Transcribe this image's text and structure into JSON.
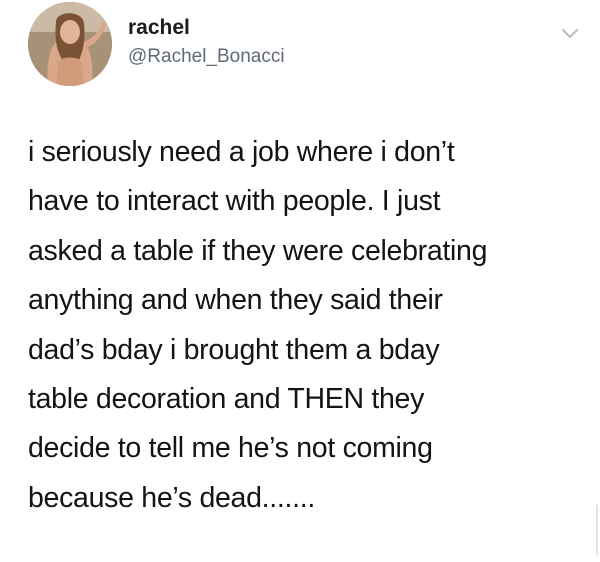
{
  "user": {
    "display_name": "rachel",
    "handle": "@Rachel_Bonacci"
  },
  "tweet": {
    "lines": [
      "i seriously need a job where i don’t",
      "have to interact with people. I just",
      "asked a table if they were celebrating",
      "anything and when they said their",
      "dad’s bday i brought them a bday",
      "table decoration and THEN they",
      "decide to tell me he’s not coming",
      "because he’s dead......."
    ]
  },
  "icons": {
    "avatar": "profile-photo",
    "menu": "chevron-down-icon"
  },
  "colors": {
    "handle": "#5f6a74",
    "text": "#141414",
    "chevron": "#b3bcc4"
  }
}
